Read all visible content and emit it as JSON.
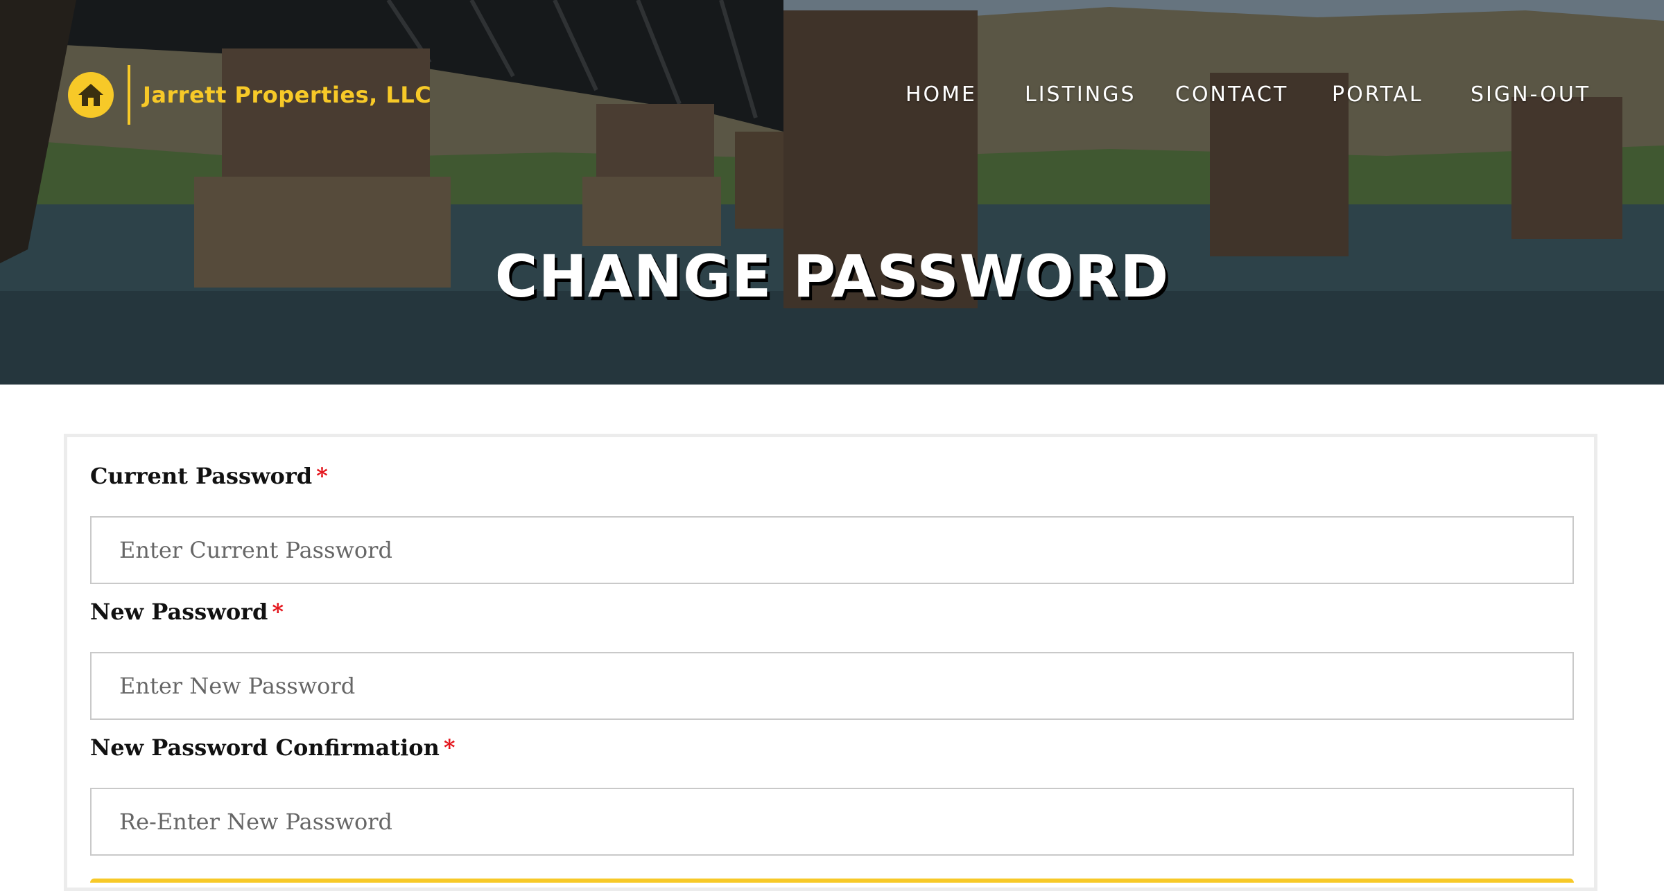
{
  "brand": {
    "name": "Jarrett Properties, LLC",
    "logo_icon": "house-icon",
    "accent_color": "#f7c928"
  },
  "nav": {
    "items": [
      {
        "label": "HOME"
      },
      {
        "label": "LISTINGS"
      },
      {
        "label": "CONTACT"
      },
      {
        "label": "PORTAL"
      },
      {
        "label": "SIGN-OUT"
      }
    ]
  },
  "hero": {
    "title": "CHANGE PASSWORD"
  },
  "form": {
    "current_password": {
      "label": "Current Password",
      "required_mark": "*",
      "placeholder": "Enter Current Password"
    },
    "new_password": {
      "label": "New Password",
      "required_mark": "*",
      "placeholder": "Enter New Password"
    },
    "confirm_password": {
      "label": "New Password Confirmation",
      "required_mark": "*",
      "placeholder": "Re-Enter New Password"
    },
    "required_color": "#e4151c"
  }
}
